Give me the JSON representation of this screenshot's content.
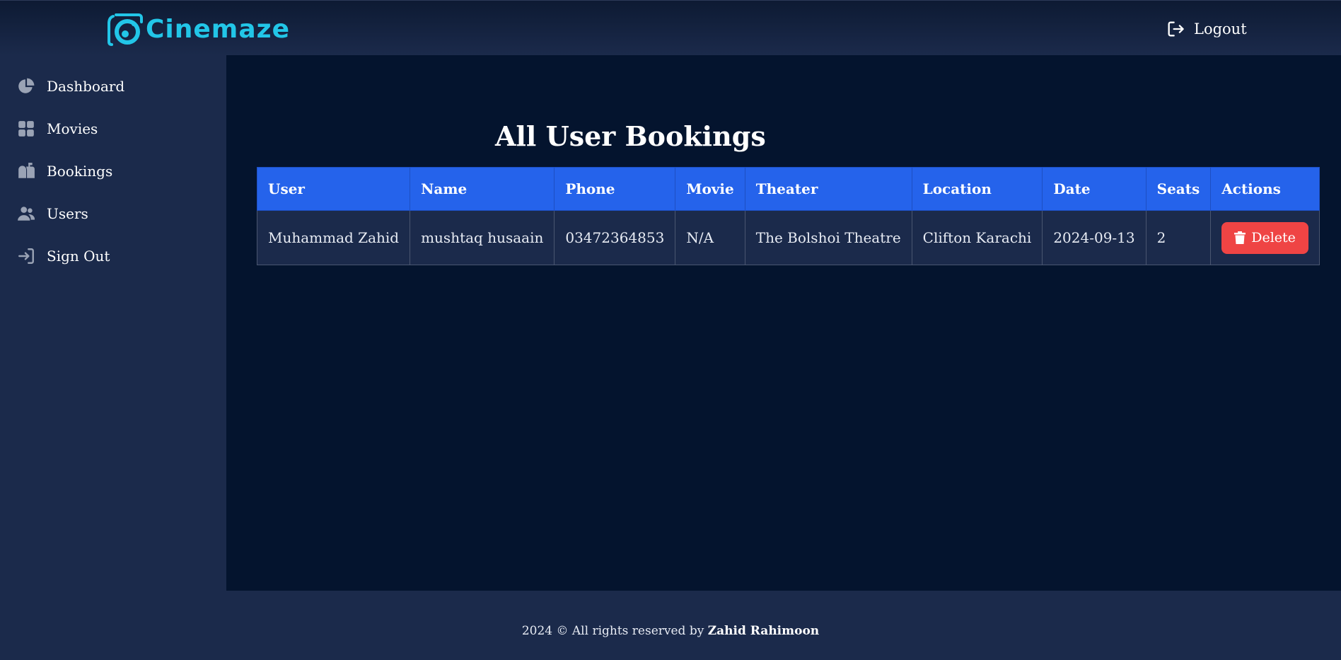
{
  "header": {
    "logo_text": "Cinemaze",
    "logout_label": "Logout"
  },
  "sidebar": {
    "items": [
      {
        "label": "Dashboard",
        "icon": "pie-chart-icon"
      },
      {
        "label": "Movies",
        "icon": "grid-icon"
      },
      {
        "label": "Bookings",
        "icon": "mailbox-icon"
      },
      {
        "label": "Users",
        "icon": "users-icon"
      },
      {
        "label": "Sign Out",
        "icon": "sign-in-arrow-icon"
      }
    ]
  },
  "main": {
    "title": "All User Bookings",
    "table": {
      "columns": [
        "User",
        "Name",
        "Phone",
        "Movie",
        "Theater",
        "Location",
        "Date",
        "Seats",
        "Actions"
      ],
      "rows": [
        {
          "user": "Muhammad Zahid",
          "name": "mushtaq husaain",
          "phone": "03472364853",
          "movie": "N/A",
          "theater": "The Bolshoi Theatre",
          "location": "Clifton Karachi",
          "date": "2024-09-13",
          "seats": "2",
          "action_label": "Delete"
        }
      ]
    }
  },
  "footer": {
    "text": "2024 © All rights reserved by",
    "author": "Zahid Rahimoon"
  },
  "colors": {
    "header_bg": "#0d1a33",
    "sidebar_bg": "#1b2a4b",
    "main_bg": "#04142e",
    "accent_blue": "#2563eb",
    "logo_cyan": "#22c6e8",
    "danger_red": "#ef4444"
  }
}
